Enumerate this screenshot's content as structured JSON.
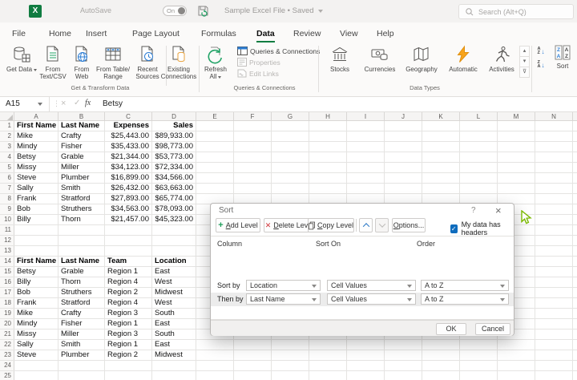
{
  "titlebar": {
    "app_logo": "X",
    "autosave_label": "AutoSave",
    "autosave_state": "On",
    "filename": "Sample Excel File • Saved",
    "search_placeholder": "Search (Alt+Q)"
  },
  "tabs": [
    {
      "label": "File",
      "active": false
    },
    {
      "label": "Home",
      "active": false
    },
    {
      "label": "Insert",
      "active": false
    },
    {
      "label": "Page Layout",
      "active": false
    },
    {
      "label": "Formulas",
      "active": false
    },
    {
      "label": "Data",
      "active": true
    },
    {
      "label": "Review",
      "active": false
    },
    {
      "label": "View",
      "active": false
    },
    {
      "label": "Help",
      "active": false
    }
  ],
  "ribbon": {
    "get_transform": {
      "group_label": "Get & Transform Data",
      "get_data": "Get Data",
      "from_text": "From Text/CSV",
      "from_web": "From Web",
      "from_table": "From Table/ Range",
      "recent_sources": "Recent Sources",
      "existing_connections": "Existing Connections"
    },
    "queries": {
      "group_label": "Queries & Connections",
      "refresh_all": "Refresh All",
      "queries_connections": "Queries & Connections",
      "properties": "Properties",
      "edit_links": "Edit Links"
    },
    "data_types": {
      "group_label": "Data Types",
      "items": [
        "Stocks",
        "Currencies",
        "Geography",
        "Automatic",
        "Activities"
      ]
    },
    "sort_filter": {
      "sort": "Sort"
    }
  },
  "formula_bar": {
    "name_box": "A15",
    "fx": "fx",
    "cancel_glyph": "×",
    "enter_glyph": "✓",
    "value": "Betsy"
  },
  "sheet": {
    "columns": [
      "A",
      "B",
      "C",
      "D",
      "E",
      "F",
      "G",
      "H",
      "I",
      "J",
      "K",
      "L",
      "M",
      "N"
    ],
    "rows_visible": 25,
    "table1": {
      "header_row": 1,
      "headers": [
        "First Name",
        "Last Name",
        "Expenses",
        "Sales"
      ],
      "rows": [
        [
          "Mike",
          "Crafty",
          "$25,443.00",
          "$89,933.00"
        ],
        [
          "Mindy",
          "Fisher",
          "$35,433.00",
          "$98,773.00"
        ],
        [
          "Betsy",
          "Grable",
          "$21,344.00",
          "$53,773.00"
        ],
        [
          "Missy",
          "Miller",
          "$34,123.00",
          "$72,334.00"
        ],
        [
          "Steve",
          "Plumber",
          "$16,899.00",
          "$34,566.00"
        ],
        [
          "Sally",
          "Smith",
          "$26,432.00",
          "$63,663.00"
        ],
        [
          "Frank",
          "Stratford",
          "$27,893.00",
          "$65,774.00"
        ],
        [
          "Bob",
          "Struthers",
          "$34,563.00",
          "$78,093.00"
        ],
        [
          "Billy",
          "Thorn",
          "$21,457.00",
          "$45,323.00"
        ]
      ]
    },
    "table2": {
      "header_row": 14,
      "headers": [
        "First Name",
        "Last Name",
        "Team",
        "Location"
      ],
      "rows": [
        [
          "Betsy",
          "Grable",
          "Region 1",
          "East"
        ],
        [
          "Billy",
          "Thorn",
          "Region 4",
          "West"
        ],
        [
          "Bob",
          "Struthers",
          "Region 2",
          "Midwest"
        ],
        [
          "Frank",
          "Stratford",
          "Region 4",
          "West"
        ],
        [
          "Mike",
          "Crafty",
          "Region 3",
          "South"
        ],
        [
          "Mindy",
          "Fisher",
          "Region 1",
          "East"
        ],
        [
          "Missy",
          "Miller",
          "Region 3",
          "South"
        ],
        [
          "Sally",
          "Smith",
          "Region 1",
          "East"
        ],
        [
          "Steve",
          "Plumber",
          "Region 2",
          "Midwest"
        ]
      ]
    }
  },
  "sort_dialog": {
    "title": "Sort",
    "help_glyph": "?",
    "close_glyph": "×",
    "add_level": "Add Level",
    "delete_level": "Delete Level",
    "copy_level": "Copy Level",
    "options": "Options...",
    "headers_checkbox": "My data has headers",
    "checkbox_checked": true,
    "check_glyph": "✓",
    "col_headers": [
      "Column",
      "Sort On",
      "Order"
    ],
    "rows": [
      {
        "label": "Sort by",
        "column": "Location",
        "sort_on": "Cell Values",
        "order": "A to Z",
        "selected": false
      },
      {
        "label": "Then by",
        "column": "Last Name",
        "sort_on": "Cell Values",
        "order": "A to Z",
        "selected": true
      }
    ],
    "ok": "OK",
    "cancel": "Cancel",
    "mnemonics": {
      "add_level": 0,
      "delete_level": 0,
      "copy_level": 0,
      "options": 0,
      "headers_checkbox": 12
    }
  },
  "colors": {
    "excel_green": "#107C41",
    "lightning_orange": "#F8A41B",
    "accent_blue": "#2B7CD3",
    "checkbox_blue": "#0F6CBD"
  }
}
